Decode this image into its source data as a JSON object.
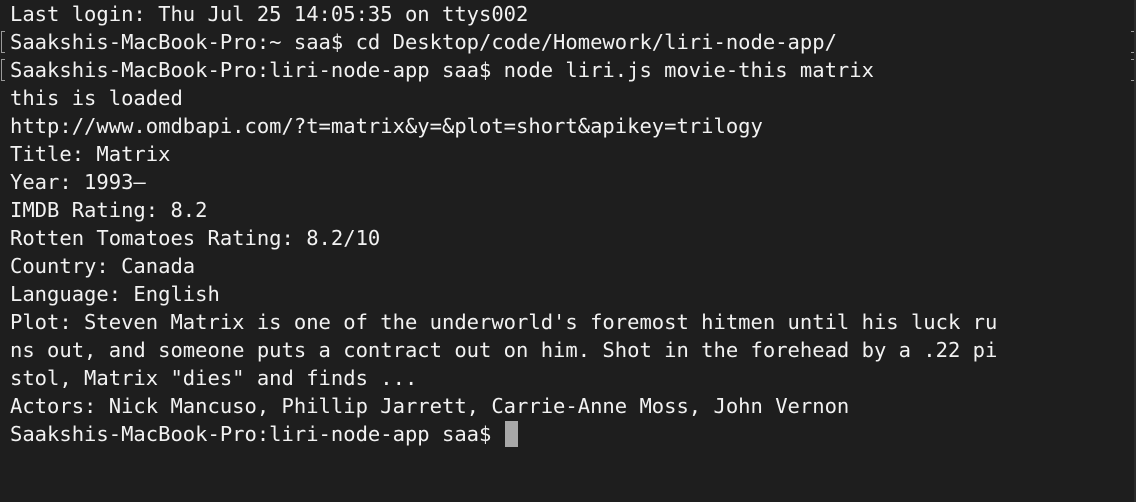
{
  "terminal": {
    "lines": [
      "Last login: Thu Jul 25 14:05:35 on ttys002",
      "Saakshis-MacBook-Pro:~ saa$ cd Desktop/code/Homework/liri-node-app/",
      "Saakshis-MacBook-Pro:liri-node-app saa$ node liri.js movie-this matrix",
      "this is loaded",
      "http://www.omdbapi.com/?t=matrix&y=&plot=short&apikey=trilogy",
      "Title: Matrix",
      "Year: 1993–",
      "IMDB Rating: 8.2",
      "Rotten Tomatoes Rating: 8.2/10",
      "Country: Canada",
      "Language: English",
      "Plot: Steven Matrix is one of the underworld's foremost hitmen until his luck ru",
      "ns out, and someone puts a contract out on him. Shot in the forehead by a .22 pi",
      "stol, Matrix \"dies\" and finds ...",
      "Actors: Nick Mancuso, Phillip Jarrett, Carrie-Anne Moss, John Vernon"
    ],
    "prompt": "Saakshis-MacBook-Pro:liri-node-app saa$ "
  }
}
